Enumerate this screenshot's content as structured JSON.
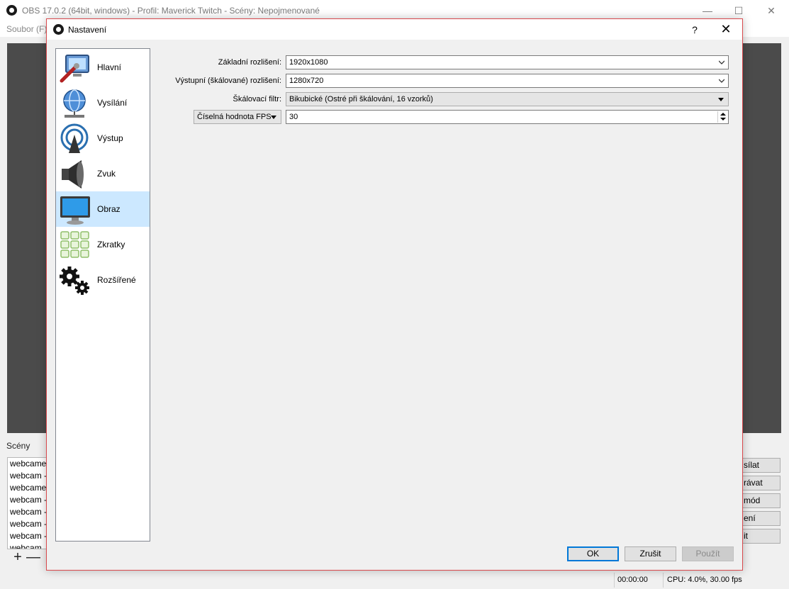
{
  "main_window": {
    "title": "OBS 17.0.2 (64bit, windows) - Profil: Maverick Twitch - Scény: Nepojmenované",
    "menu": [
      "Soubor (F)"
    ],
    "window_controls": {
      "minimize": "—",
      "maximize": "☐",
      "close": "✕"
    }
  },
  "scenes": {
    "label": "Scény",
    "items": [
      "webcame",
      "webcam -",
      "webcame",
      "webcam -",
      "webcam -",
      "webcam -",
      "webcam -",
      "webcam"
    ],
    "add_symbol": "+",
    "remove_symbol": "—"
  },
  "controls": [
    "sílat",
    "rávat",
    "mód",
    "ení",
    "it"
  ],
  "status": {
    "time": "00:00:00",
    "cpu": "CPU: 4.0%, 30.00 fps"
  },
  "dialog": {
    "title": "Nastavení",
    "help": "?",
    "close": "✕",
    "sidebar": [
      {
        "label": "Hlavní",
        "icon": "monitor-wrench-icon"
      },
      {
        "label": "Vysílání",
        "icon": "globe-network-icon"
      },
      {
        "label": "Výstup",
        "icon": "broadcast-antenna-icon"
      },
      {
        "label": "Zvuk",
        "icon": "speaker-icon"
      },
      {
        "label": "Obraz",
        "icon": "monitor-icon",
        "selected": true
      },
      {
        "label": "Zkratky",
        "icon": "keyboard-keys-icon"
      },
      {
        "label": "Rozšířené",
        "icon": "gears-icon"
      }
    ],
    "form": {
      "base_resolution_label": "Základní rozlišení:",
      "base_resolution_value": "1920x1080",
      "output_resolution_label": "Výstupní (škálované) rozlišení:",
      "output_resolution_value": "1280x720",
      "scale_filter_label": "Škálovací filtr:",
      "scale_filter_value": "Bikubické (Ostré při škálování, 16 vzorků)",
      "fps_type_value": "Číselná hodnota FPS",
      "fps_value": "30"
    },
    "buttons": {
      "ok": "OK",
      "cancel": "Zrušit",
      "apply": "Použít"
    }
  },
  "colors": {
    "selection": "#cce8ff",
    "dialog_border": "#d9494d",
    "default_button_border": "#0078d7"
  }
}
